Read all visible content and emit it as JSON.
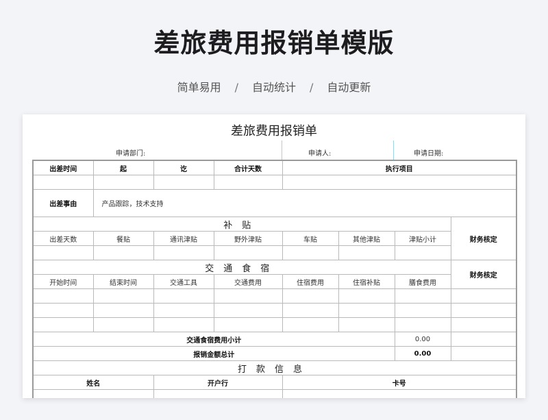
{
  "page": {
    "title": "差旅费用报销单模版",
    "features": [
      "简单易用",
      "自动统计",
      "自动更新"
    ],
    "separator": "/"
  },
  "form": {
    "title": "差旅费用报销单",
    "meta": {
      "department_label": "申请部门:",
      "applicant_label": "申请人:",
      "date_label": "申请日期:"
    },
    "trip": {
      "headers": [
        "出差时间",
        "起",
        "讫",
        "合计天数",
        "执行项目"
      ],
      "reason_label": "出差事由",
      "reason_value": "产品跟踪，技术支持"
    },
    "allowance": {
      "section_title": "补贴",
      "columns": [
        "出差天数",
        "餐贴",
        "通讯津贴",
        "野外津贴",
        "车贴",
        "其他津贴",
        "津贴小计"
      ],
      "audit_label": "财务核定"
    },
    "travel": {
      "section_title": "交通食宿",
      "columns": [
        "开始时间",
        "结束时间",
        "交通工具",
        "交通费用",
        "住宿费用",
        "住宿补贴",
        "膳食费用"
      ],
      "audit_label": "财务核定",
      "subtotal_label": "交通食宿费用小计",
      "subtotal_value": "0.00",
      "total_label": "报销金额总计",
      "total_value": "0.00"
    },
    "payment": {
      "section_title": "打款信息",
      "columns": [
        "姓名",
        "开户行",
        "卡号"
      ]
    }
  }
}
